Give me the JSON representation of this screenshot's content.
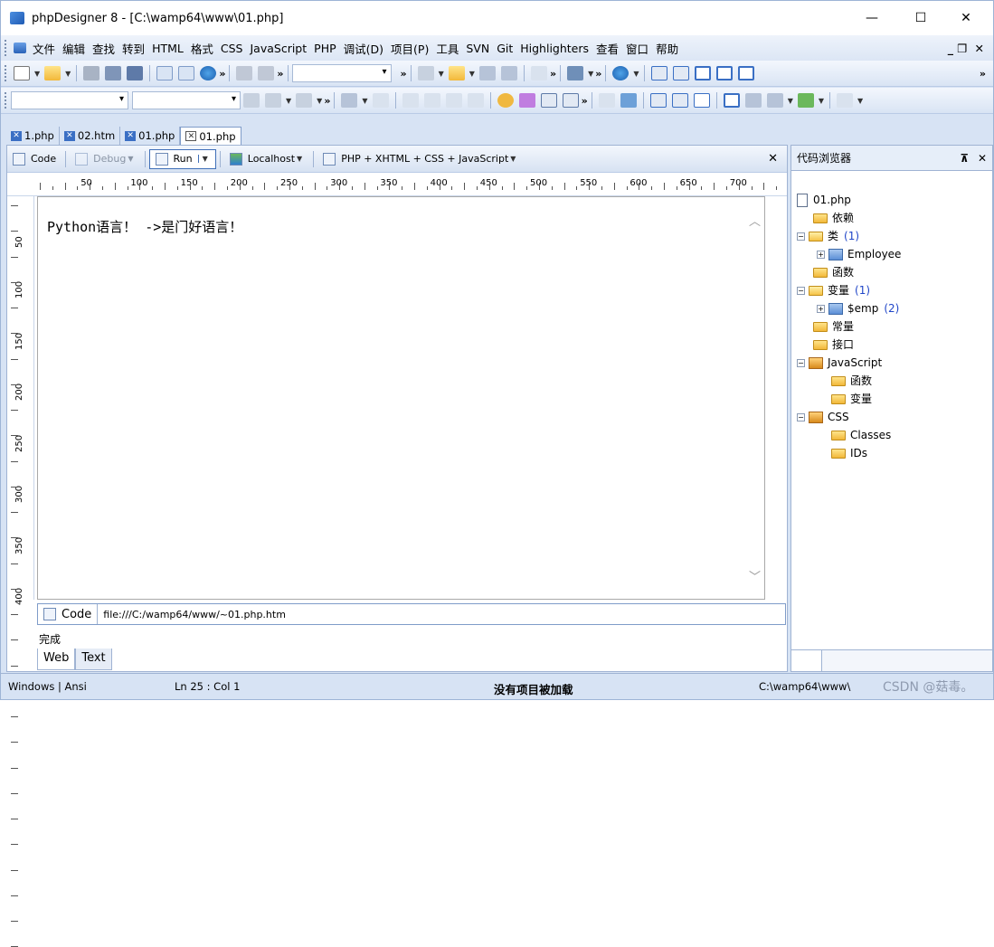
{
  "window": {
    "title": "phpDesigner 8 - [C:\\wamp64\\www\\01.php]",
    "minimize": "—",
    "maximize": "☐",
    "close": "✕"
  },
  "menu": [
    "文件",
    "编辑",
    "查找",
    "转到",
    "HTML",
    "格式",
    "CSS",
    "JavaScript",
    "PHP",
    "调试(D)",
    "项目(P)",
    "工具",
    "SVN",
    "Git",
    "Highlighters",
    "查看",
    "窗口",
    "帮助"
  ],
  "menu_right": {
    "restore": "_ ❐",
    "close": "✕"
  },
  "tabs": [
    "1.php",
    "02.htm",
    "01.php",
    "01.php"
  ],
  "editor_toolbar": {
    "code": "Code",
    "debug": "Debug",
    "run": "Run",
    "localhost": "Localhost",
    "mode": "PHP + XHTML + CSS + JavaScript",
    "close": "✕"
  },
  "ruler_h": [
    "50",
    "100",
    "150",
    "200",
    "250",
    "300",
    "350",
    "400",
    "450",
    "500",
    "550",
    "600",
    "650",
    "700"
  ],
  "ruler_v": [
    "50",
    "100",
    "150",
    "200",
    "250",
    "300",
    "350",
    "400"
  ],
  "code_text": "Python语言！ ->是门好语言！",
  "url_bar": {
    "code_label": "Code",
    "url": "file:///C:/wamp64/www/~01.php.htm"
  },
  "status_done": "完成",
  "view_tabs": [
    "Web",
    "Text"
  ],
  "browser": {
    "title": "代码浏览器",
    "pin": "⊼",
    "close": "✕",
    "root": "01.php",
    "deps": "依赖",
    "classes": "类",
    "classes_count": "(1)",
    "employee": "Employee",
    "functions": "函数",
    "variables": "变量",
    "variables_count": "(1)",
    "emp": "$emp",
    "emp_count": "(2)",
    "constants": "常量",
    "interfaces": "接口",
    "javascript": "JavaScript",
    "js_functions": "函数",
    "js_variables": "变量",
    "css": "CSS",
    "css_classes": "Classes",
    "css_ids": "IDs"
  },
  "statusbar": {
    "encoding": "Windows | Ansi",
    "position": "Ln   25 : Col  1",
    "project": "没有项目被加载",
    "path": "C:\\wamp64\\www\\",
    "watermark": "CSDN @菇毒。"
  }
}
